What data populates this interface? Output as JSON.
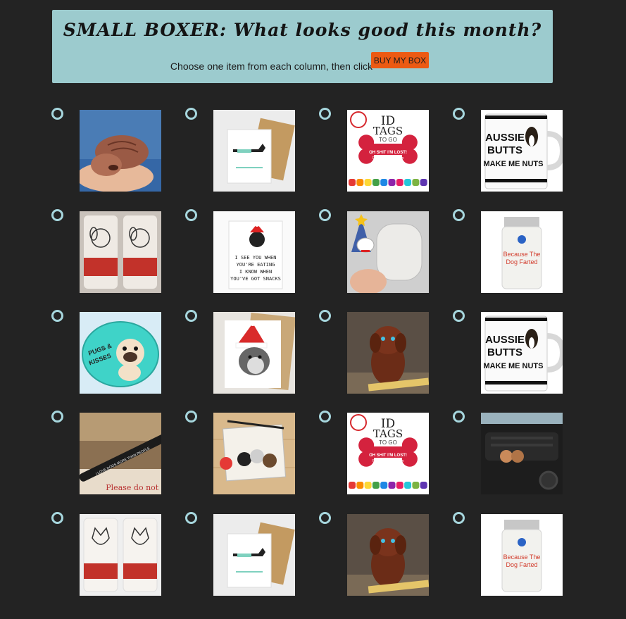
{
  "header": {
    "title": "SMALL BOXER: What looks good this month?",
    "instructions": "Choose one item from each column, then click",
    "buy_button_label": "BUY MY BOX"
  },
  "colors": {
    "background": "#232323",
    "banner": "#9ccbce",
    "button": "#ec5a13",
    "radio_ring": "#a6d6dd"
  },
  "rows": [
    {
      "col1": {
        "image": "clay-puppy-photo"
      },
      "col2": {
        "image": "dachshund-card"
      },
      "col3": {
        "image": "id-tags-bone",
        "texts": [
          "ID",
          "TAGS",
          "TO GO",
          "OH SHIT I'M LOST!",
          "Please call my mom",
          "she is ugly crying",
          "...really ugly crying"
        ]
      },
      "col4": {
        "image": "aussie-mug",
        "texts": [
          "AUSSIE",
          "BUTTS",
          "MAKE ME NUTS"
        ]
      }
    },
    {
      "col1": {
        "image": "puppy-tumbler"
      },
      "col2": {
        "image": "snacks-dog-card",
        "texts": [
          "I SEE YOU WHEN",
          "YOU'RE EATING",
          "I KNOW WHEN",
          "YOU'VE GOT SNACKS"
        ]
      },
      "col3": {
        "image": "paint-ornament"
      },
      "col4": {
        "image": "candle-jar",
        "texts": [
          "Because The",
          "Dog Farted"
        ]
      }
    },
    {
      "col1": {
        "image": "pugs-kisses-magnet",
        "texts": [
          "PUGS &",
          "KISSES"
        ]
      },
      "col2": {
        "image": "husky-santa-card"
      },
      "col3": {
        "image": "ceramic-dog"
      },
      "col4": {
        "image": "aussie-mug",
        "texts": [
          "AUSSIE",
          "BUTTS",
          "MAKE ME NUTS"
        ]
      }
    },
    {
      "col1": {
        "image": "pen-photo",
        "texts": [
          "I LOVE DOGS MORE THAN PEOPLE",
          "Please do not b"
        ]
      },
      "col2": {
        "image": "dog-print-card"
      },
      "col3": {
        "image": "id-tags-bone",
        "texts": [
          "ID",
          "TAGS",
          "TO GO",
          "OH SHIT I'M LOST!",
          "Please call my mom",
          "she is ugly crying",
          "...really ugly crying"
        ]
      },
      "col4": {
        "image": "car-vent-pom"
      }
    },
    {
      "col1": {
        "image": "frenchie-tumbler"
      },
      "col2": {
        "image": "dachshund-card"
      },
      "col3": {
        "image": "ceramic-dog"
      },
      "col4": {
        "image": "candle-jar",
        "texts": [
          "Because The",
          "Dog Farted"
        ]
      }
    }
  ]
}
